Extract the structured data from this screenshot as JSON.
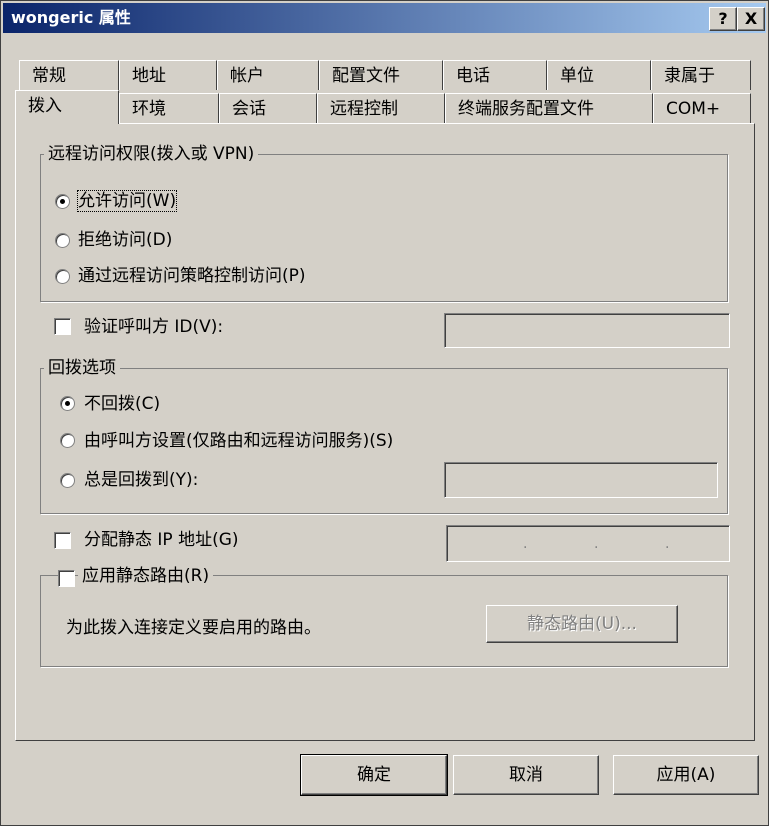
{
  "window": {
    "title": "wongeric 属性",
    "help_button": "?",
    "close_button": "X"
  },
  "tabs_back": [
    "常规",
    "地址",
    "帐户",
    "配置文件",
    "电话",
    "单位",
    "隶属于"
  ],
  "tabs_front": [
    "拨入",
    "环境",
    "会话",
    "远程控制",
    "终端服务配置文件",
    "COM+"
  ],
  "remote_access": {
    "legend": "远程访问权限(拨入或 VPN)",
    "options": [
      "允许访问(W)",
      "拒绝访问(D)",
      "通过远程访问策略控制访问(P)"
    ],
    "selected": 0
  },
  "verify_caller": {
    "label": "验证呼叫方 ID(V):",
    "checked": false,
    "value": ""
  },
  "callback": {
    "legend": "回拨选项",
    "options": [
      "不回拨(C)",
      "由呼叫方设置(仅路由和远程访问服务)(S)",
      "总是回拨到(Y):"
    ],
    "selected": 0,
    "value": ""
  },
  "static_ip": {
    "label": "分配静态 IP 地址(G)",
    "checked": false,
    "ip_separator": "."
  },
  "static_routes": {
    "label": "应用静态路由(R)",
    "checked": false,
    "description": "为此拨入连接定义要启用的路由。",
    "button": "静态路由(U)..."
  },
  "buttons": {
    "ok": "确定",
    "cancel": "取消",
    "apply": "应用(A)"
  }
}
